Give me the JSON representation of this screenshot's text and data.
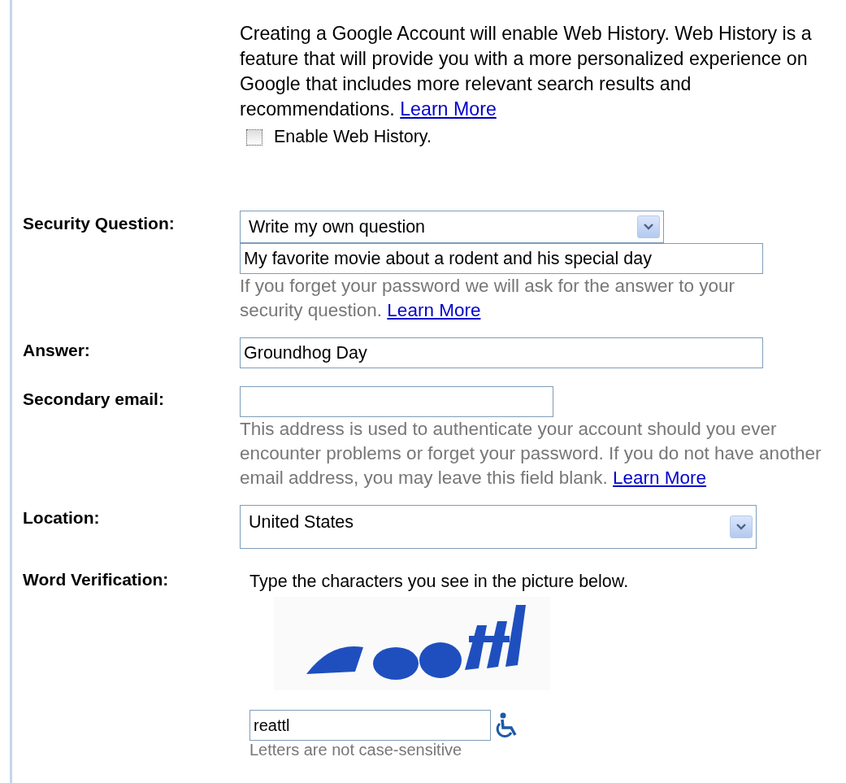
{
  "web_history": {
    "description": "Creating a Google Account will enable Web History. Web History is a feature that will provide you with a more personalized experience on Google that includes more relevant search results and recommendations.",
    "learn_more": "Learn More",
    "checkbox": {
      "label": "Enable Web History.",
      "checked": false
    }
  },
  "security_question": {
    "label": "Security Question:",
    "selected_option": "Write my own question",
    "custom_question": "My favorite movie about a rodent and his special day",
    "help": "If you forget your password we will ask for the answer to your security question.",
    "learn_more": "Learn More"
  },
  "answer": {
    "label": "Answer:",
    "value": "Groundhog Day"
  },
  "secondary_email": {
    "label": "Secondary email:",
    "help": "This address is used to authenticate your account should you ever encounter problems or forget your password. If you do not have another email address, you may leave this field blank.",
    "learn_more": "Learn More"
  },
  "location": {
    "label": "Location:",
    "selected_option": "United States"
  },
  "word_verification": {
    "label": "Word Verification:",
    "instruction": "Type the characters you see in the picture below.",
    "value": "reattl",
    "hint": "Letters are not case-sensitive"
  }
}
